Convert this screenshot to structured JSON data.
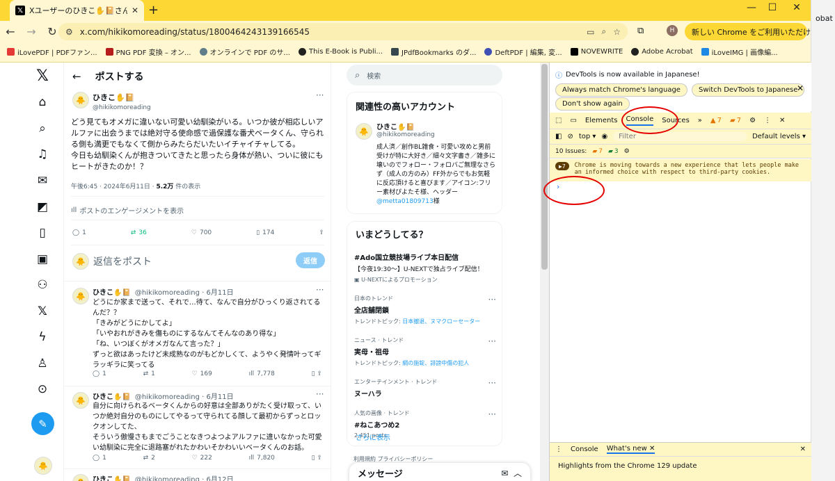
{
  "browser": {
    "tab_title": "Xユーザーのひきこ✋📔さん:「どう見",
    "url": "x.com/hikikomoreading/status/1800464243139166545",
    "update_label": "新しい Chrome をご利用いただけます",
    "profile_initial": "H",
    "right_partial": "obat"
  },
  "bookmarks": [
    {
      "label": "iLovePDF | PDFファン...",
      "color": "#e53935"
    },
    {
      "label": "PNG PDF 変換 – オン...",
      "color": "#b71c1c"
    },
    {
      "label": "オンラインで PDF のサ...",
      "color": "#607d8b"
    },
    {
      "label": "This E-Book is Publi...",
      "color": "#212121"
    },
    {
      "label": "JPdfBookmarks のダ...",
      "color": "#37474f"
    },
    {
      "label": "DeftPDF | 編集, 変...",
      "color": "#3f51b5"
    },
    {
      "label": "NOVEWRITE",
      "color": "#000000"
    },
    {
      "label": "Adobe Acrobat",
      "color": "#212121"
    },
    {
      "label": "iLoveIMG | 画像編...",
      "color": "#1e88e5"
    }
  ],
  "header": {
    "title": "ポストする"
  },
  "post": {
    "author": "ひきこ✋📔",
    "handle": "@hikikomoreading",
    "text": "どう見てもオメガに違いない可愛い幼馴染がいる。いつか彼が相応しいアルファに出会うまでは絶対守る使命感で過保護な番犬ベータくん、守られる側も満更でもなくて側からみたらだいたいイチャイチャしてる。\n今日も幼馴染くんが抱きついてきたと思ったら身体が熱い、ついに彼にもヒートがきたのか！？",
    "time": "午後6:45 · 2024年6月11日 · ",
    "views": "5.2万",
    "views_suffix": " 件の表示",
    "engagement": "ポストのエンゲージメントを表示",
    "replies": "1",
    "reposts": "36",
    "likes": "700",
    "bookmarks": "174",
    "reply_placeholder": "返信をポスト",
    "reply_button": "返信"
  },
  "replies": [
    {
      "author": "ひきこ✋📔",
      "handle": "@hikikomoreading · 6月11日",
      "text": "どうにか家まで送って、それで…待て、なんで自分がひっくり返されてるんだ？？\n「きみがどうにかしてよ」\n「いやおれがきみを傷ものにするなんてそんなのあり得な」\n「ね、いつぼくがオメガなんて言った？」\nずっと欲はあったけど未成熟なのがもどかしくて、ようやく発情叶ってギラッギラに笑ってる",
      "replies": "1",
      "reposts": "1",
      "likes": "169",
      "views": "7,778"
    },
    {
      "author": "ひきこ✋📔",
      "handle": "@hikikomoreading · 6月11日",
      "text": "自分に向けられるベータくんからの好意は全部ありがたく受け取って、いつか絶対自分のものにしてやるって守られてる顔して最初からずっとロックオンしてた、\nそういう傲慢さもまでごうことなきつよつよアルファに違いなかった可愛い幼馴染に完全に退路塞がれたかわいそかわいいベータくんのお話。",
      "replies": "1",
      "reposts": "2",
      "likes": "222",
      "views": "7,820"
    },
    {
      "author": "ひきこ✋📔",
      "handle": "@hikikomoreading · 6月12日"
    }
  ],
  "sidebar": {
    "search_placeholder": "検索",
    "related_title": "関連性の高いアカウント",
    "account_name": "ひきこ✋📔",
    "account_handle": "@hikikomoreading",
    "account_bio": "成人済／創作BL雑食・可愛い攻めと男前受けが特に大好き／細々文字書き／雑多に壊いのでフォロー・フォロバご無理なさらず（成人の方のみ）FF外からでもお気軽に反応頂けると喜びます／アイコン:フリー素材ぴよたそ様、ヘッダー",
    "account_bio_link": "@metta01809713",
    "account_bio_tail": "様",
    "trends_title": "いまどうしてる？",
    "trends": [
      {
        "cat": "",
        "name": "#Ado国立競技場ライブ本日配信",
        "sub": "【今夜19:30〜】U-NEXTで独占ライブ配信！",
        "sub2": "U-NEXTによるプロモーション",
        "more": false
      },
      {
        "cat": "日本のトレンド",
        "name": "全店舗閉鎖",
        "sub": "トレンドトピック: ",
        "link": "日本撤退、ヌマクローセーター",
        "more": true
      },
      {
        "cat": "ニュース · トレンド",
        "name": "実母・祖母",
        "sub": "トレンドトピック: ",
        "link": "網の施錠、誹謗中傷の犯人",
        "more": true
      },
      {
        "cat": "エンターテインメント · トレンド",
        "name": "ヌーハラ",
        "sub": "",
        "more": true
      },
      {
        "cat": "人気の画像 · トレンド",
        "name": "#ねこあつめ2",
        "sub": "2,451 posts",
        "more": true
      }
    ],
    "show_more": "さらに表示",
    "footer": "利用規約  プライバシーポリシー",
    "messages": "メッセージ"
  },
  "devtools": {
    "banner": "DevTools is now available in Japanese!",
    "btn1": "Always match Chrome's language",
    "btn2": "Switch DevTools to Japanese",
    "btn3": "Don't show again",
    "tabs": [
      "Elements",
      "Console",
      "Sources"
    ],
    "warn_count": "7",
    "err_count": "7",
    "context": "top",
    "filter": "Filter",
    "levels": "Default levels",
    "issues_label": "10 Issues:",
    "issues_warn": "7",
    "issues_info": "3",
    "msg_count": "7",
    "message": "Chrome is moving towards a new experience that lets people make an informed choice with respect to third-party cookies.",
    "prompt": "›",
    "drawer_tabs": [
      "Console",
      "What's new"
    ],
    "drawer_text": "Highlights from the Chrome 129 update"
  }
}
